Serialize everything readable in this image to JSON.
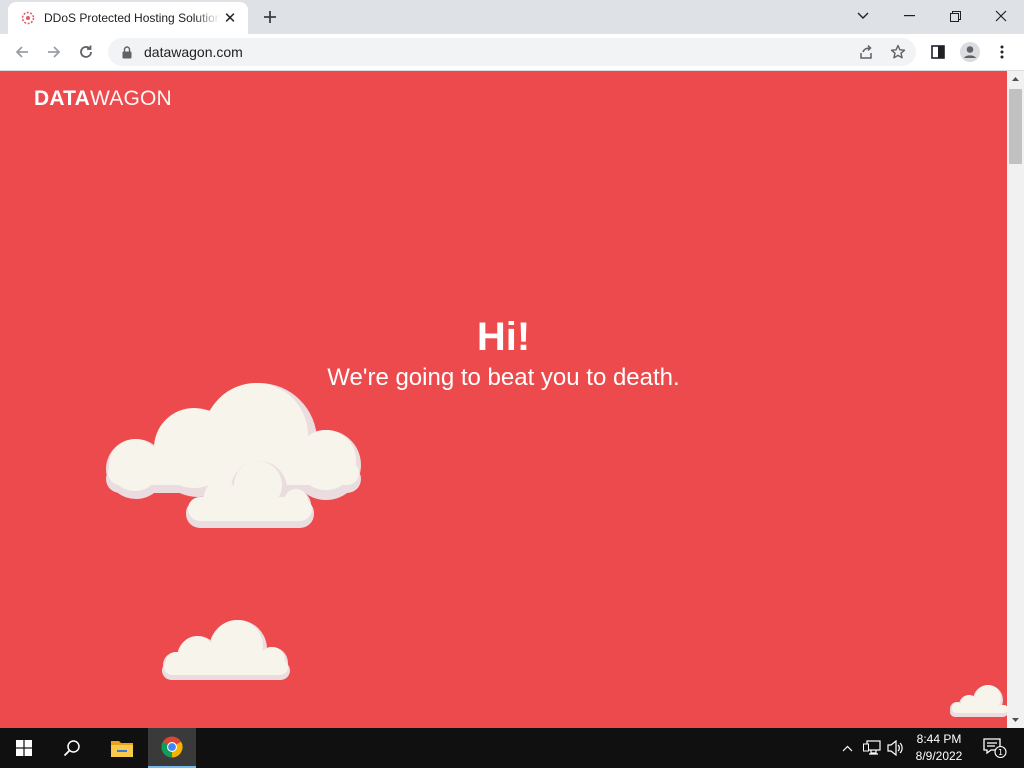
{
  "browser": {
    "tab_title": "DDoS Protected Hosting Solutions",
    "url": "datawagon.com"
  },
  "page": {
    "logo_bold": "DATA",
    "logo_light": "WAGON",
    "hero_title": "Hi!",
    "hero_subtitle": "We're going to beat you to death.",
    "background_color": "#ec4a4d"
  },
  "taskbar": {
    "time": "8:44 PM",
    "date": "8/9/2022",
    "notification_count": "1"
  },
  "icons": [
    "favicon-icon",
    "close-icon",
    "plus-icon",
    "chevron-down-icon",
    "minimize-icon",
    "restore-icon",
    "close-window-icon",
    "back-icon",
    "forward-icon",
    "reload-icon",
    "lock-icon",
    "share-icon",
    "star-icon",
    "side-panel-icon",
    "profile-icon",
    "menu-icon",
    "windows-start-icon",
    "search-icon",
    "file-explorer-icon",
    "chrome-icon",
    "chevron-up-icon",
    "network-icon",
    "volume-icon",
    "notification-icon"
  ]
}
